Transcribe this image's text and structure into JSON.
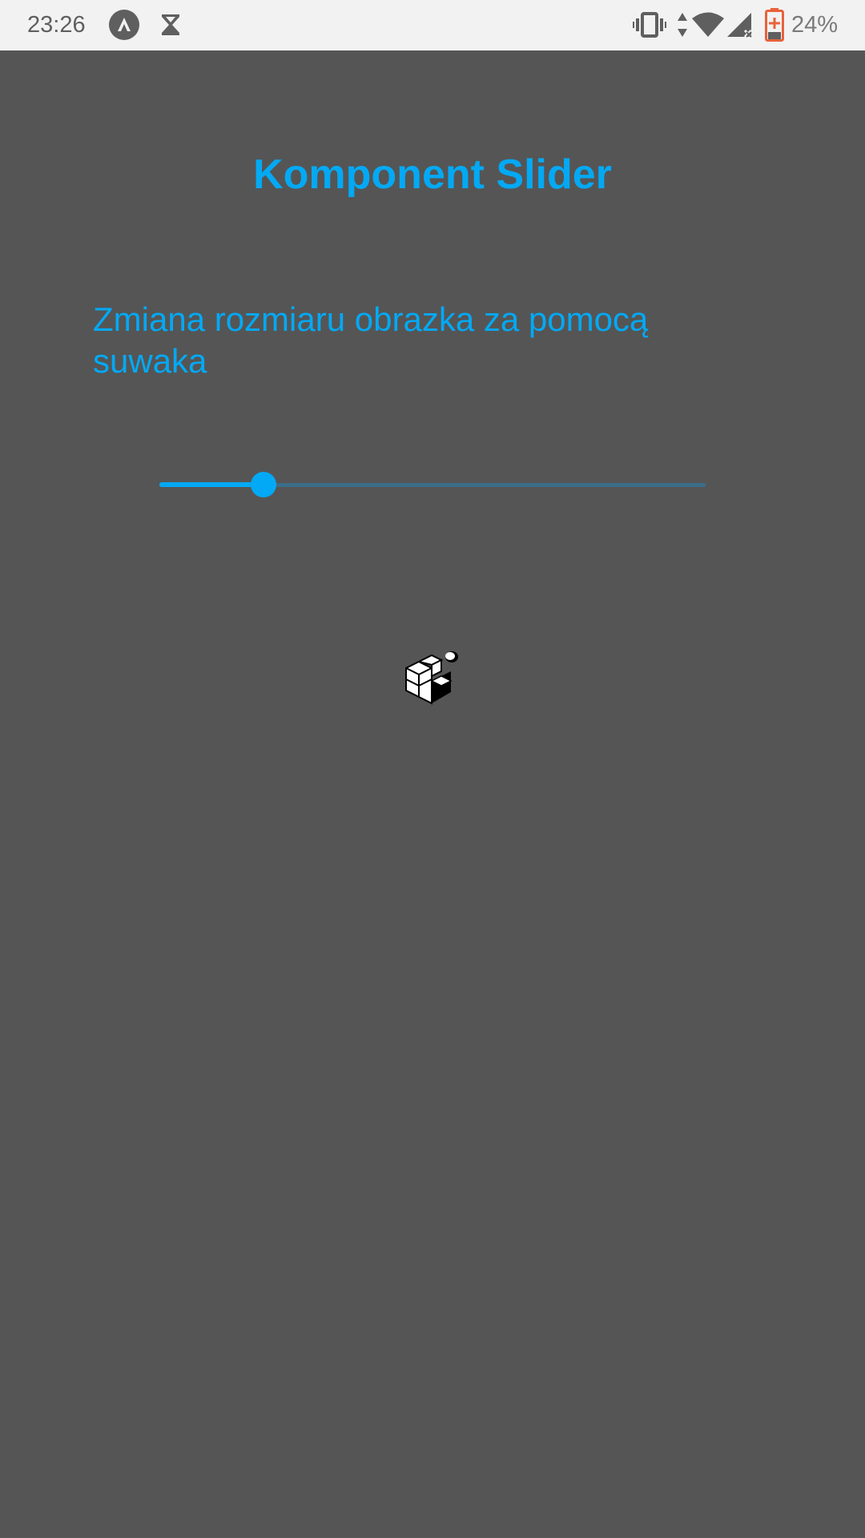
{
  "status_bar": {
    "time": "23:26",
    "left_icons": [
      "app-notification-icon",
      "hourglass-icon"
    ],
    "right_icons": [
      "vibrate-icon",
      "data-arrows-icon",
      "wifi-icon",
      "cell-signal-icon",
      "battery-charging-icon"
    ],
    "battery_percent": "24%",
    "battery_color": "#e8623a"
  },
  "screen": {
    "title": "Komponent Slider",
    "description": "Zmiana rozmiaru obrazka za pomocą suwaka",
    "accent_color": "#03a9f4",
    "background_color": "#555555"
  },
  "slider": {
    "value_fraction": 0.19,
    "active_color": "#03a9f4",
    "inactive_color": "#3c6d88"
  },
  "image": {
    "icon": "cube-blocks-icon"
  }
}
